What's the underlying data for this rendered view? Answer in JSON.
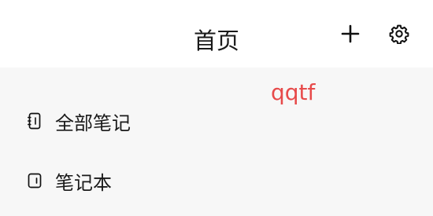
{
  "header": {
    "title": "首页",
    "add_icon": "plus-icon",
    "settings_icon": "gear-icon"
  },
  "overlay": {
    "text": "qqtf",
    "color": "#e74a4a"
  },
  "nav": {
    "items": [
      {
        "label": "全部笔记",
        "icon": "notes-icon"
      },
      {
        "label": "笔记本",
        "icon": "notebook-icon"
      }
    ]
  },
  "colors": {
    "header_bg": "#ffffff",
    "page_bg": "#f7f7f7",
    "text": "#1a1a1a"
  }
}
